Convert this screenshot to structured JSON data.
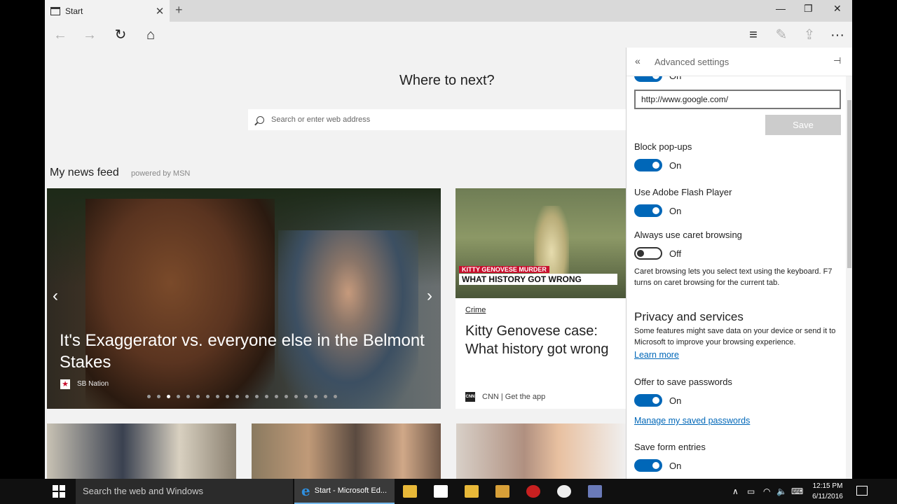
{
  "browser": {
    "tab_title": "Start",
    "tab_close": "✕",
    "new_tab": "+",
    "minimize": "—",
    "restore": "❐",
    "close": "✕",
    "nav": {
      "back": "←",
      "forward": "→",
      "refresh": "↻",
      "home": "⌂",
      "hub": "≡",
      "note": "✎",
      "share": "⇪",
      "more": "···"
    }
  },
  "start_page": {
    "heading": "Where to next?",
    "search_placeholder": "Search or enter web address",
    "feed_title": "My news feed",
    "feed_powered": "powered by MSN",
    "hero": {
      "title": "It's Exaggerator vs. everyone else in the Belmont Stakes",
      "source": "SB Nation",
      "source_icon": "★",
      "prev": "‹",
      "next": "›",
      "dot_count": 20,
      "active_dot": 2
    },
    "card2": {
      "ticker_top": "KITTY GENOVESE MURDER",
      "ticker": "WHAT HISTORY GOT WRONG",
      "category": "Crime",
      "title": "Kitty Genovese case: What history got wrong",
      "source_icon": "CNN",
      "source": "CNN | Get the app"
    }
  },
  "settings": {
    "back": "«",
    "title": "Advanced settings",
    "pin": "⊣",
    "partial_toggle_text": "On",
    "home_url": "http://www.google.com/",
    "save_label": "Save",
    "popups_label": "Block pop-ups",
    "popups_state": "On",
    "flash_label": "Use Adobe Flash Player",
    "flash_state": "On",
    "caret_label": "Always use caret browsing",
    "caret_state": "Off",
    "caret_note": "Caret browsing lets you select text using the keyboard. F7 turns on caret browsing for the current tab.",
    "privacy_title": "Privacy and services",
    "privacy_note": "Some features might save data on your device or send it to Microsoft to improve your browsing experience.",
    "learn_more": "Learn more",
    "passwords_label": "Offer to save passwords",
    "passwords_state": "On",
    "manage_passwords": "Manage my saved passwords",
    "forms_label": "Save form entries",
    "forms_state": "On"
  },
  "taskbar": {
    "search_placeholder": "Search the web and Windows",
    "active_app": "Start - Microsoft Ed...",
    "tray_chevron": "∧",
    "tray_battery": "▭",
    "tray_wifi": "◠",
    "tray_volume": "🔈",
    "tray_keyboard": "⌨",
    "time": "12:15 PM",
    "date": "6/11/2016"
  },
  "colors": {
    "accent": "#0067b8",
    "window_bg": "#f2f2f2",
    "taskbar": "#101010"
  }
}
